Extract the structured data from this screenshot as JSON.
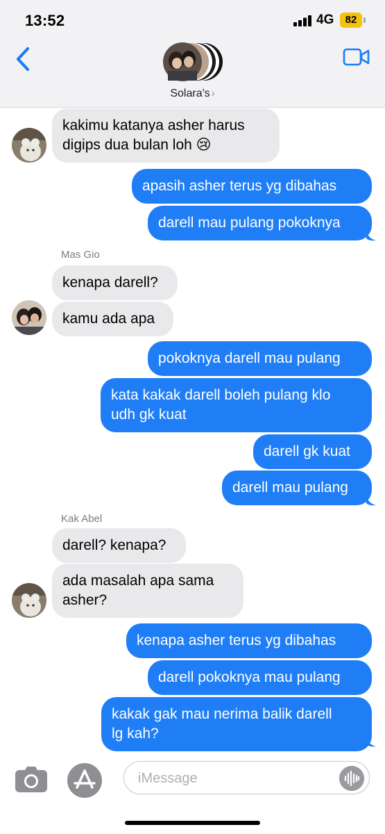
{
  "status_bar": {
    "time": "13:52",
    "network": "4G",
    "battery": "82"
  },
  "header": {
    "group_name": "Solara's",
    "chevron": "›"
  },
  "messages": [
    {
      "direction": "in",
      "lines": [
        "kakimu katanya asher harus",
        "digips dua bulan loh 😢"
      ]
    },
    {
      "direction": "out",
      "lines": [
        "apasih asher terus yg dibahas"
      ]
    },
    {
      "direction": "out",
      "lines": [
        "darell mau pulang pokoknya"
      ]
    },
    {
      "direction": "sender",
      "lines": [
        "Mas Gio"
      ]
    },
    {
      "direction": "in",
      "lines": [
        "kenapa darell?"
      ]
    },
    {
      "direction": "in",
      "lines": [
        "kamu ada apa"
      ]
    },
    {
      "direction": "out",
      "lines": [
        "pokoknya darell mau pulang"
      ]
    },
    {
      "direction": "out",
      "lines": [
        "kata kakak darell boleh pulang klo",
        "udh gk kuat"
      ]
    },
    {
      "direction": "out",
      "lines": [
        "darell gk kuat"
      ]
    },
    {
      "direction": "out",
      "lines": [
        "darell mau pulang"
      ]
    },
    {
      "direction": "sender",
      "lines": [
        "Kak Abel"
      ]
    },
    {
      "direction": "in",
      "lines": [
        "darell? kenapa?"
      ]
    },
    {
      "direction": "in",
      "lines": [
        "ada masalah apa sama",
        "asher?"
      ]
    },
    {
      "direction": "out",
      "lines": [
        "kenapa asher terus yg dibahas"
      ]
    },
    {
      "direction": "out",
      "lines": [
        "darell pokoknya mau pulang"
      ]
    },
    {
      "direction": "out",
      "lines": [
        "kakak gak mau nerima balik darell",
        "lg kah?"
      ]
    }
  ],
  "composer": {
    "placeholder": "iMessage"
  },
  "colors": {
    "outgoing": "#1f7ef6",
    "incoming": "#e9e9eb",
    "accent": "#1a7cf5"
  },
  "icons": [
    "back-chevron-icon",
    "video-camera-icon",
    "camera-icon",
    "app-store-icon",
    "audio-waveform-icon"
  ]
}
